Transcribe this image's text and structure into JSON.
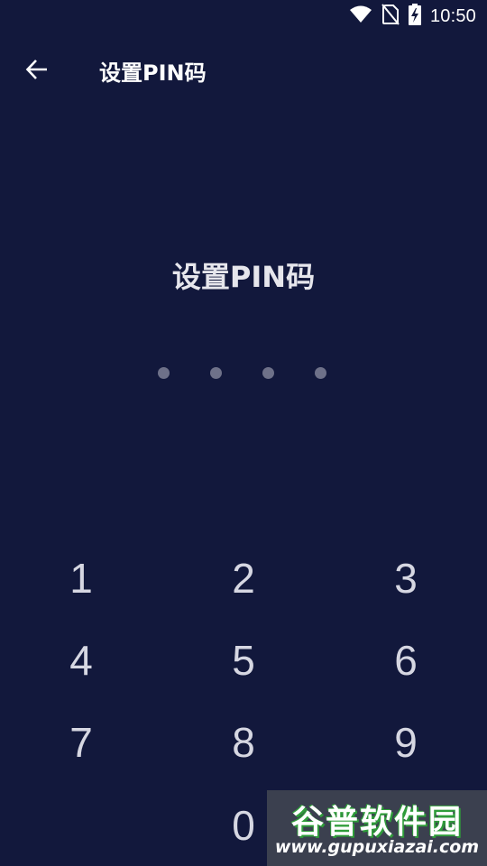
{
  "status_bar": {
    "time": "10:50",
    "icons": [
      "wifi-icon",
      "no-sim-icon",
      "battery-charging-icon"
    ]
  },
  "header": {
    "back_icon": "arrow-left-icon",
    "title": "设置PIN码"
  },
  "pin_entry": {
    "prompt": "设置PIN码",
    "digits_total": 4,
    "digits_entered": 0
  },
  "keypad": {
    "keys": [
      "1",
      "2",
      "3",
      "4",
      "5",
      "6",
      "7",
      "8",
      "9",
      "0"
    ]
  },
  "watermark": {
    "title": "谷普软件园",
    "url": "www.gupuxiazai.com"
  },
  "colors": {
    "background": "#12183c",
    "dot": "#6e7189",
    "key_text": "#d6d7e2"
  }
}
